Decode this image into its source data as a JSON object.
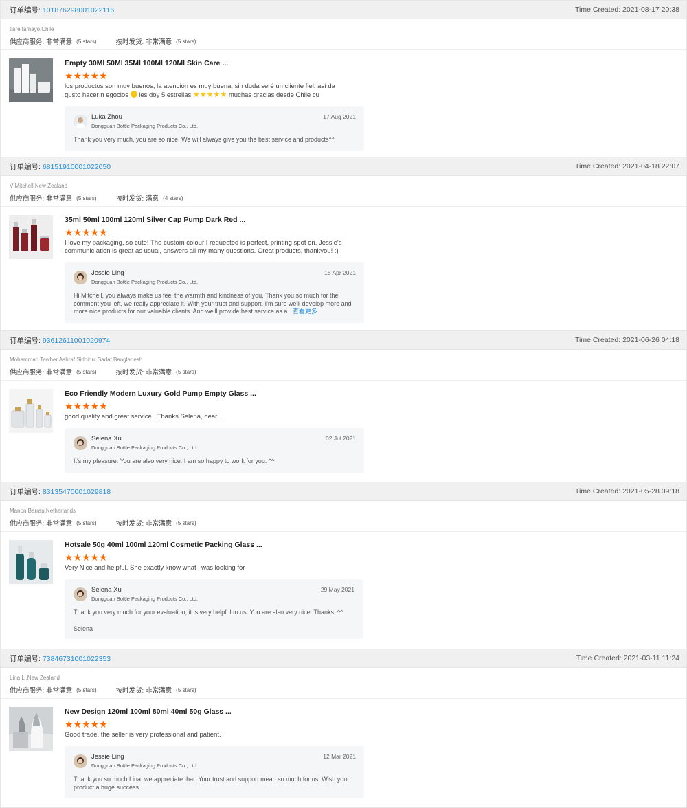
{
  "labels": {
    "order_prefix": "订单编号:",
    "time_prefix": "Time Created:",
    "supplier_service": "供应商服务:",
    "on_time_shipping": "按时发货:",
    "star": "★"
  },
  "reviews": [
    {
      "order_no": "101876298001022116",
      "time_created": "2021-08-17 20:38",
      "buyer": "tiare tamayo,Chile",
      "supplier_rating": "非常满意",
      "supplier_stars": "(5 stars)",
      "shipping_rating": "非常满意",
      "shipping_stars": "(5 stars)",
      "product_title": "Empty 30Ml 50Ml 35Ml 100Ml 120Ml Skin Care ...",
      "review_text_a": "los productos son muy buenos, la atención es muy buena, sin duda seré un cliente fiel. así da gusto hacer n egocios",
      "review_text_b": "les doy 5 estrellas",
      "review_text_c": "muchas gracias desde Chile cu",
      "reply_name": "Luka Zhou",
      "reply_company": "Dongguan Bottle Packaging Products Co., Ltd.",
      "reply_date": "17 Aug 2021",
      "reply_text": "Thank you very much,  you are so nice. We will always give you the best service and products^^"
    },
    {
      "order_no": "68151910001022050",
      "time_created": "2021-04-18 22:07",
      "buyer": "V Mitchell,New Zealand",
      "supplier_rating": "非常满意",
      "supplier_stars": "(5 stars)",
      "shipping_rating": "满意",
      "shipping_stars": "(4 stars)",
      "product_title": "35ml 50ml 100ml 120ml Silver Cap Pump Dark Red ...",
      "review_text": "I love my packaging, so cute! The custom colour I requested is perfect, printing spot on. Jessie's communic ation is great as usual, answers all my many questions. Great products, thankyou! :)",
      "reply_name": "Jessie Ling",
      "reply_company": "Dongguan Bottle Packaging Products Co., Ltd.",
      "reply_date": "18 Apr 2021",
      "reply_text": "Hi Mitchell, you always make us feel the warmth and kindness of you. Thank you so much for the comment you left, we really appreciate it. With your trust and support, I'm sure we'll develop more and more nice products for our valuable clients. And we'll  provide best service as a...",
      "more_label": "查看更多"
    },
    {
      "order_no": "93612611001020974",
      "time_created": "2021-06-26 04:18",
      "buyer": "Mohammad Tawher Ashraf Siddiqui Sadat,Bangladesh",
      "supplier_rating": "非常满意",
      "supplier_stars": "(5 stars)",
      "shipping_rating": "非常满意",
      "shipping_stars": "(5 stars)",
      "product_title": "Eco Friendly Modern Luxury Gold Pump Empty Glass ...",
      "review_text": "good quality and great service...Thanks Selena, dear...",
      "reply_name": "Selena Xu",
      "reply_company": "Dongguan Bottle Packaging Products Co., Ltd.",
      "reply_date": "02 Jul 2021",
      "reply_text": "It's my pleasure. You are also very nice. I am so happy to work for you. ^^"
    },
    {
      "order_no": "83135470001029818",
      "time_created": "2021-05-28 09:18",
      "buyer": "Manon Barrau,Netherlands",
      "supplier_rating": "非常满意",
      "supplier_stars": "(5 stars)",
      "shipping_rating": "非常满意",
      "shipping_stars": "(5 stars)",
      "product_title": "Hotsale 50g 40ml 100ml 120ml Cosmetic Packing Glass ...",
      "review_text": "Very Nice and helpful. She exactly know what i was looking for",
      "reply_name": "Selena Xu",
      "reply_company": "Dongguan Bottle Packaging Products Co., Ltd.",
      "reply_date": "29 May 2021",
      "reply_text": "Thank you very much for your evaluation, it is very helpful to us. You are also very nice. Thanks. ^^",
      "reply_sign": "Selena"
    },
    {
      "order_no": "73846731001022353",
      "time_created": "2021-03-11 11:24",
      "buyer": "Lina Li,New Zealand",
      "supplier_rating": "非常满意",
      "supplier_stars": "(5 stars)",
      "shipping_rating": "非常满意",
      "shipping_stars": "(5 stars)",
      "product_title": "New Design 120ml 100ml 80ml 40ml 50g Glass ...",
      "review_text": "Good trade, the seller is very professional and patient.",
      "reply_name": "Jessie Ling",
      "reply_company": "Dongguan Bottle Packaging Products Co., Ltd.",
      "reply_date": "12 Mar 2021",
      "reply_text": "Thank you so much Lina, we appreciate that. Your trust and support mean so much for us. Wish your product a huge success."
    }
  ]
}
